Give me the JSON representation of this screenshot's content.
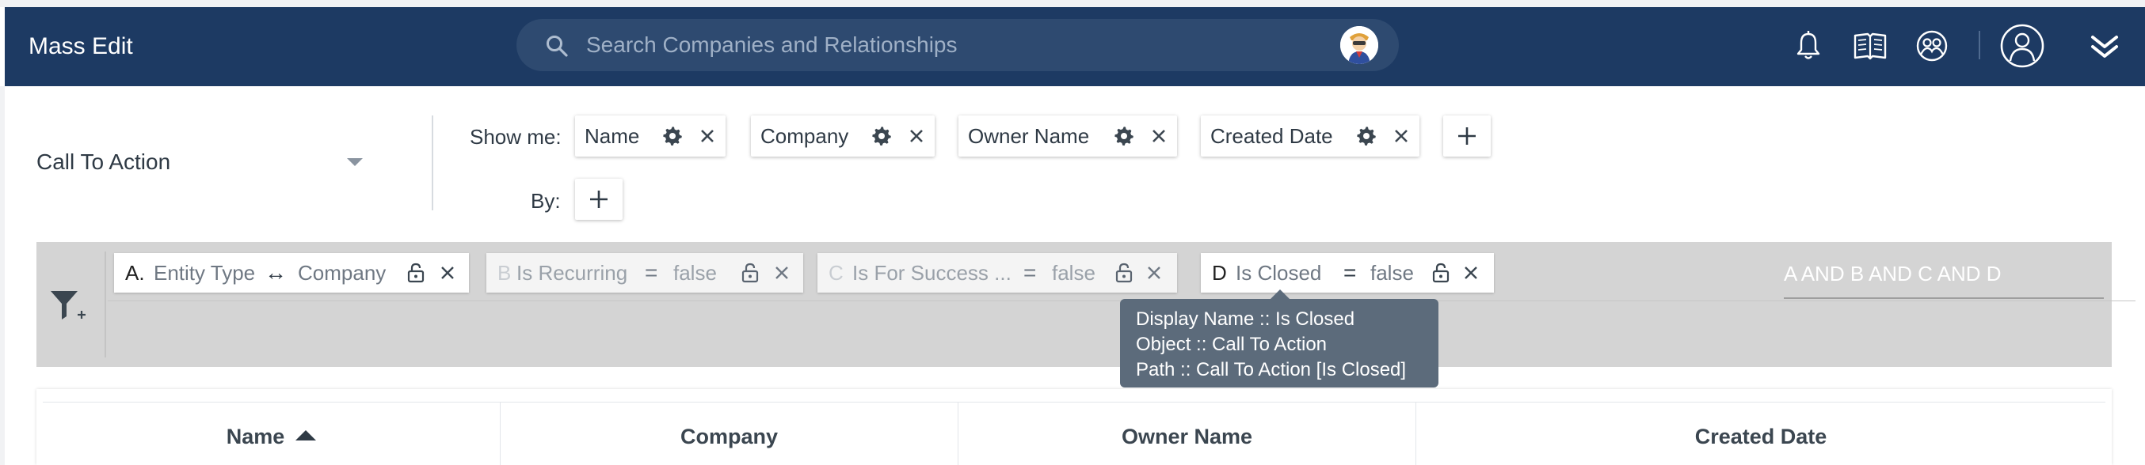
{
  "header": {
    "title": "Mass Edit",
    "search": {
      "placeholder": "Search Companies and Relationships",
      "value": ""
    },
    "icons": [
      "bell-icon",
      "book-icon",
      "support-icon",
      "user-icon",
      "double-chevron-down-icon"
    ],
    "colors": {
      "background": "#1d3a63",
      "search_bg": "#2e4a70"
    }
  },
  "report": {
    "selected": "Call To Action"
  },
  "show_me": {
    "label": "Show me:",
    "fields": [
      {
        "label": "Name"
      },
      {
        "label": "Company"
      },
      {
        "label": "Owner Name"
      },
      {
        "label": "Created Date"
      }
    ]
  },
  "by": {
    "label": "By:"
  },
  "filters": [
    {
      "letter": "A.",
      "field": "Entity Type",
      "operator": "↔",
      "value": "Company",
      "enabled": true
    },
    {
      "letter": "B",
      "field": "Is Recurring",
      "operator": "=",
      "value": "false",
      "enabled": false
    },
    {
      "letter": "C",
      "field": "Is For Success ...",
      "operator": "=",
      "value": "false",
      "enabled": false
    },
    {
      "letter": "D",
      "field": "Is Closed",
      "operator": "=",
      "value": "false",
      "enabled": true
    }
  ],
  "filter_logic": {
    "placeholder": "A AND B AND C AND D",
    "value": ""
  },
  "tooltip": {
    "lines": [
      "Display Name :: Is Closed",
      "Object :: Call To Action",
      "Path ::  Call To Action [Is Closed]"
    ]
  },
  "table": {
    "columns": [
      {
        "label": "Name",
        "sorted": "asc"
      },
      {
        "label": "Company"
      },
      {
        "label": "Owner Name"
      },
      {
        "label": "Created Date"
      }
    ]
  }
}
